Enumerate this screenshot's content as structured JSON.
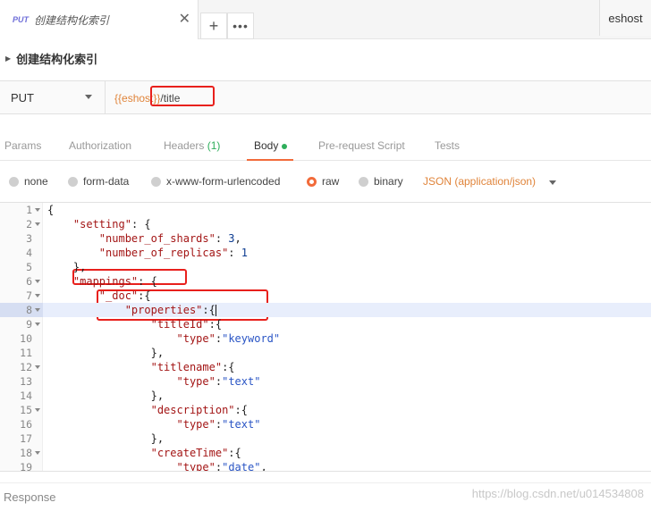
{
  "tab": {
    "method": "PUT",
    "title": "创建结构化索引",
    "close": "✕"
  },
  "tab_buttons": {
    "new": "+",
    "more": "•••"
  },
  "environment": "eshost",
  "request": {
    "name": "创建结构化索引"
  },
  "urlbar": {
    "method": "PUT",
    "url_var": "{{eshost}}",
    "url_path": "/title"
  },
  "request_tabs": [
    {
      "label": "Params"
    },
    {
      "label": "Authorization"
    },
    {
      "label": "Headers",
      "count": "(1)"
    },
    {
      "label": "Body"
    },
    {
      "label": "Pre-request Script"
    },
    {
      "label": "Tests"
    }
  ],
  "body_types": [
    "none",
    "form-data",
    "x-www-form-urlencoded",
    "raw",
    "binary"
  ],
  "selected_body_type": "raw",
  "content_type": "JSON (application/json)",
  "code": [
    {
      "n": "1",
      "fold": true,
      "indent": "",
      "parts": [
        [
          "p",
          "{"
        ]
      ]
    },
    {
      "n": "2",
      "fold": true,
      "indent": "    ",
      "parts": [
        [
          "k",
          "\"setting\""
        ],
        [
          "p",
          ": {"
        ]
      ]
    },
    {
      "n": "3",
      "fold": false,
      "indent": "        ",
      "parts": [
        [
          "k",
          "\"number_of_shards\""
        ],
        [
          "p",
          ": "
        ],
        [
          "n",
          "3"
        ],
        [
          "p",
          ","
        ]
      ]
    },
    {
      "n": "4",
      "fold": false,
      "indent": "        ",
      "parts": [
        [
          "k",
          "\"number_of_replicas\""
        ],
        [
          "p",
          ": "
        ],
        [
          "n",
          "1"
        ]
      ]
    },
    {
      "n": "5",
      "fold": false,
      "indent": "    ",
      "parts": [
        [
          "p",
          "},"
        ]
      ]
    },
    {
      "n": "6",
      "fold": true,
      "indent": "    ",
      "parts": [
        [
          "k",
          "\"mappings\""
        ],
        [
          "p",
          ": {"
        ]
      ]
    },
    {
      "n": "7",
      "fold": true,
      "indent": "        ",
      "parts": [
        [
          "k",
          "\"_doc\""
        ],
        [
          "p",
          ":{"
        ]
      ]
    },
    {
      "n": "8",
      "fold": true,
      "indent": "            ",
      "parts": [
        [
          "k",
          "\"properties\""
        ],
        [
          "p",
          ":{"
        ]
      ],
      "current": true
    },
    {
      "n": "9",
      "fold": true,
      "indent": "                ",
      "parts": [
        [
          "k",
          "\"titleId\""
        ],
        [
          "p",
          ":{"
        ]
      ]
    },
    {
      "n": "10",
      "fold": false,
      "indent": "                    ",
      "parts": [
        [
          "k",
          "\"type\""
        ],
        [
          "p",
          ":"
        ],
        [
          "s",
          "\"keyword\""
        ]
      ]
    },
    {
      "n": "11",
      "fold": false,
      "indent": "                ",
      "parts": [
        [
          "p",
          "},"
        ]
      ]
    },
    {
      "n": "12",
      "fold": true,
      "indent": "                ",
      "parts": [
        [
          "k",
          "\"titlename\""
        ],
        [
          "p",
          ":{"
        ]
      ]
    },
    {
      "n": "13",
      "fold": false,
      "indent": "                    ",
      "parts": [
        [
          "k",
          "\"type\""
        ],
        [
          "p",
          ":"
        ],
        [
          "s",
          "\"text\""
        ]
      ]
    },
    {
      "n": "14",
      "fold": false,
      "indent": "                ",
      "parts": [
        [
          "p",
          "},"
        ]
      ]
    },
    {
      "n": "15",
      "fold": true,
      "indent": "                ",
      "parts": [
        [
          "k",
          "\"description\""
        ],
        [
          "p",
          ":{"
        ]
      ]
    },
    {
      "n": "16",
      "fold": false,
      "indent": "                    ",
      "parts": [
        [
          "k",
          "\"type\""
        ],
        [
          "p",
          ":"
        ],
        [
          "s",
          "\"text\""
        ]
      ]
    },
    {
      "n": "17",
      "fold": false,
      "indent": "                ",
      "parts": [
        [
          "p",
          "},"
        ]
      ]
    },
    {
      "n": "18",
      "fold": true,
      "indent": "                ",
      "parts": [
        [
          "k",
          "\"createTime\""
        ],
        [
          "p",
          ":{"
        ]
      ]
    },
    {
      "n": "19",
      "fold": false,
      "indent": "                    ",
      "parts": [
        [
          "k",
          "\"type\""
        ],
        [
          "p",
          ":"
        ],
        [
          "s",
          "\"date\""
        ],
        [
          "p",
          ","
        ]
      ]
    }
  ],
  "response_label": "Response",
  "watermark": "https://blog.csdn.net/u014534808",
  "colors": {
    "accent": "#f26b3a",
    "variable": "#e0843a",
    "annotation": "#e8201c",
    "active_dot": "#2eae5b"
  }
}
